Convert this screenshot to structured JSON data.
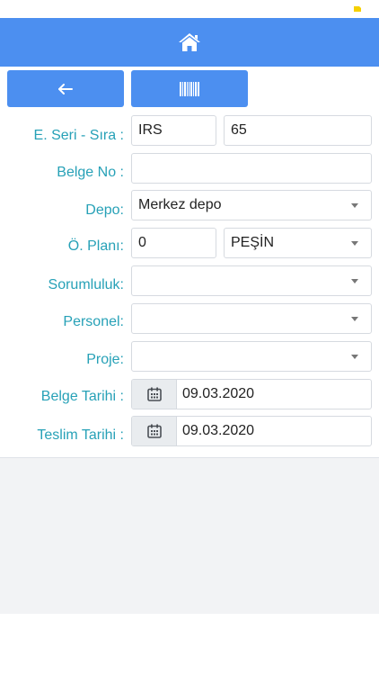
{
  "colors": {
    "header": "#4c8ff0",
    "label": "#27a1b7",
    "battery": "#f5d000"
  },
  "icons": {
    "header": "home-icon",
    "back": "arrow-left-icon",
    "barcode": "barcode-icon",
    "date": "calendar-icon"
  },
  "form": {
    "seri": {
      "label": "E. Seri - Sıra :",
      "series": "IRS",
      "number": "65"
    },
    "belge_no": {
      "label": "Belge No :",
      "value": ""
    },
    "depo": {
      "label": "Depo:",
      "value": "Merkez depo"
    },
    "odeme": {
      "label": "Ö. Planı:",
      "value": "0",
      "type": "PEŞİN"
    },
    "sorumluluk": {
      "label": "Sorumluluk:",
      "value": ""
    },
    "personel": {
      "label": "Personel:",
      "value": ""
    },
    "proje": {
      "label": "Proje:",
      "value": ""
    },
    "belge_tarihi": {
      "label": "Belge Tarihi :",
      "value": "09.03.2020"
    },
    "teslim_tarihi": {
      "label": "Teslim Tarihi :",
      "value": "09.03.2020"
    }
  }
}
